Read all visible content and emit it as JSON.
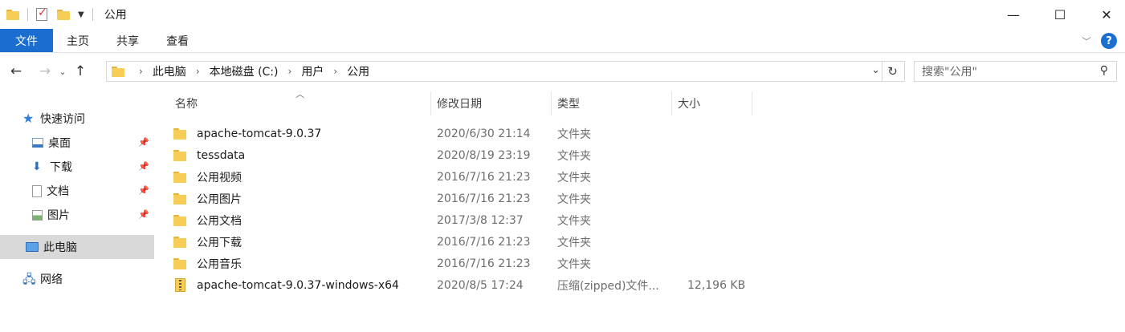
{
  "window": {
    "title": "公用",
    "controls": {
      "minimize": "—",
      "maximize": "☐",
      "close": "✕"
    }
  },
  "ribbon": {
    "tabs": [
      {
        "label": "文件",
        "active": true
      },
      {
        "label": "主页"
      },
      {
        "label": "共享"
      },
      {
        "label": "查看"
      }
    ],
    "accent_color": "#1b6ecf"
  },
  "address": {
    "breadcrumbs": [
      "此电脑",
      "本地磁盘 (C:)",
      "用户",
      "公用"
    ],
    "search_placeholder": "搜索\"公用\""
  },
  "sidebar": {
    "quick_access": {
      "label": "快速访问",
      "icon": "star-icon"
    },
    "pinned": [
      {
        "label": "桌面",
        "icon": "desktop-icon"
      },
      {
        "label": "下载",
        "icon": "download-icon"
      },
      {
        "label": "文档",
        "icon": "document-icon"
      },
      {
        "label": "图片",
        "icon": "pictures-icon"
      }
    ],
    "this_pc": {
      "label": "此电脑",
      "icon": "computer-icon",
      "selected": true
    },
    "network": {
      "label": "网络",
      "icon": "network-icon"
    }
  },
  "columns": {
    "name": "名称",
    "date": "修改日期",
    "type": "类型",
    "size": "大小"
  },
  "files": [
    {
      "name": "apache-tomcat-9.0.37",
      "date": "2020/6/30 21:14",
      "type": "文件夹",
      "size": "",
      "icon": "folder-icon"
    },
    {
      "name": "tessdata",
      "date": "2020/8/19 23:19",
      "type": "文件夹",
      "size": "",
      "icon": "folder-icon"
    },
    {
      "name": "公用视频",
      "date": "2016/7/16 21:23",
      "type": "文件夹",
      "size": "",
      "icon": "folder-icon"
    },
    {
      "name": "公用图片",
      "date": "2016/7/16 21:23",
      "type": "文件夹",
      "size": "",
      "icon": "folder-icon"
    },
    {
      "name": "公用文档",
      "date": "2017/3/8 12:37",
      "type": "文件夹",
      "size": "",
      "icon": "folder-icon"
    },
    {
      "name": "公用下载",
      "date": "2016/7/16 21:23",
      "type": "文件夹",
      "size": "",
      "icon": "folder-icon"
    },
    {
      "name": "公用音乐",
      "date": "2016/7/16 21:23",
      "type": "文件夹",
      "size": "",
      "icon": "folder-icon"
    },
    {
      "name": "apache-tomcat-9.0.37-windows-x64",
      "date": "2020/8/5 17:24",
      "type": "压缩(zipped)文件...",
      "size": "12,196 KB",
      "icon": "zip-icon"
    }
  ]
}
